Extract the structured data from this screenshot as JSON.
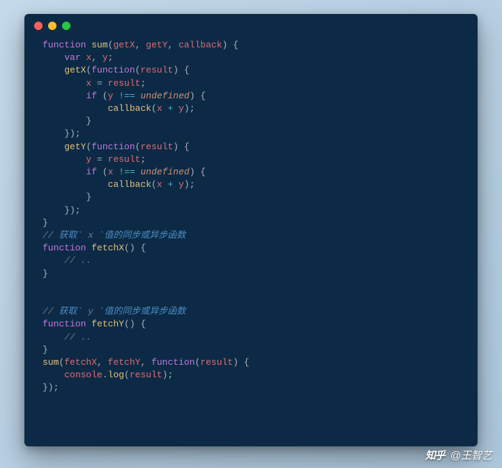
{
  "watermark": {
    "logo": "知乎",
    "attribution": "@王智艺"
  },
  "code_lines": [
    {
      "spans": [
        {
          "cls": "tok-kw",
          "t": "function"
        },
        {
          "cls": "tok-punc",
          "t": " "
        },
        {
          "cls": "tok-fn",
          "t": "sum"
        },
        {
          "cls": "tok-punc",
          "t": "("
        },
        {
          "cls": "tok-name",
          "t": "getX"
        },
        {
          "cls": "tok-punc",
          "t": ", "
        },
        {
          "cls": "tok-name",
          "t": "getY"
        },
        {
          "cls": "tok-punc",
          "t": ", "
        },
        {
          "cls": "tok-name",
          "t": "callback"
        },
        {
          "cls": "tok-punc",
          "t": ") {"
        }
      ]
    },
    {
      "spans": [
        {
          "cls": "tok-punc",
          "t": "    "
        },
        {
          "cls": "tok-kw",
          "t": "var"
        },
        {
          "cls": "tok-punc",
          "t": " "
        },
        {
          "cls": "tok-name",
          "t": "x"
        },
        {
          "cls": "tok-punc",
          "t": ", "
        },
        {
          "cls": "tok-name",
          "t": "y"
        },
        {
          "cls": "tok-punc",
          "t": ";"
        }
      ]
    },
    {
      "spans": [
        {
          "cls": "tok-punc",
          "t": "    "
        },
        {
          "cls": "tok-fn",
          "t": "getX"
        },
        {
          "cls": "tok-punc",
          "t": "("
        },
        {
          "cls": "tok-kw",
          "t": "function"
        },
        {
          "cls": "tok-punc",
          "t": "("
        },
        {
          "cls": "tok-name",
          "t": "result"
        },
        {
          "cls": "tok-punc",
          "t": ") {"
        }
      ]
    },
    {
      "spans": [
        {
          "cls": "tok-punc",
          "t": "        "
        },
        {
          "cls": "tok-name",
          "t": "x"
        },
        {
          "cls": "tok-punc",
          "t": " = "
        },
        {
          "cls": "tok-name",
          "t": "result"
        },
        {
          "cls": "tok-punc",
          "t": ";"
        }
      ]
    },
    {
      "spans": [
        {
          "cls": "tok-punc",
          "t": "        "
        },
        {
          "cls": "tok-kw",
          "t": "if"
        },
        {
          "cls": "tok-punc",
          "t": " ("
        },
        {
          "cls": "tok-name",
          "t": "y"
        },
        {
          "cls": "tok-punc",
          "t": " "
        },
        {
          "cls": "tok-op",
          "t": "!=="
        },
        {
          "cls": "tok-punc",
          "t": " "
        },
        {
          "cls": "tok-const",
          "t": "undefined"
        },
        {
          "cls": "tok-punc",
          "t": ") {"
        }
      ]
    },
    {
      "spans": [
        {
          "cls": "tok-punc",
          "t": "            "
        },
        {
          "cls": "tok-fn",
          "t": "callback"
        },
        {
          "cls": "tok-punc",
          "t": "("
        },
        {
          "cls": "tok-name",
          "t": "x"
        },
        {
          "cls": "tok-punc",
          "t": " "
        },
        {
          "cls": "tok-op",
          "t": "+"
        },
        {
          "cls": "tok-punc",
          "t": " "
        },
        {
          "cls": "tok-name",
          "t": "y"
        },
        {
          "cls": "tok-punc",
          "t": ");"
        }
      ]
    },
    {
      "spans": [
        {
          "cls": "tok-punc",
          "t": "        }"
        }
      ]
    },
    {
      "spans": [
        {
          "cls": "tok-punc",
          "t": "    });"
        }
      ]
    },
    {
      "spans": [
        {
          "cls": "tok-punc",
          "t": "    "
        },
        {
          "cls": "tok-fn",
          "t": "getY"
        },
        {
          "cls": "tok-punc",
          "t": "("
        },
        {
          "cls": "tok-kw",
          "t": "function"
        },
        {
          "cls": "tok-punc",
          "t": "("
        },
        {
          "cls": "tok-name",
          "t": "result"
        },
        {
          "cls": "tok-punc",
          "t": ") {"
        }
      ]
    },
    {
      "spans": [
        {
          "cls": "tok-punc",
          "t": "        "
        },
        {
          "cls": "tok-name",
          "t": "y"
        },
        {
          "cls": "tok-punc",
          "t": " = "
        },
        {
          "cls": "tok-name",
          "t": "result"
        },
        {
          "cls": "tok-punc",
          "t": ";"
        }
      ]
    },
    {
      "spans": [
        {
          "cls": "tok-punc",
          "t": "        "
        },
        {
          "cls": "tok-kw",
          "t": "if"
        },
        {
          "cls": "tok-punc",
          "t": " ("
        },
        {
          "cls": "tok-name",
          "t": "x"
        },
        {
          "cls": "tok-punc",
          "t": " "
        },
        {
          "cls": "tok-op",
          "t": "!=="
        },
        {
          "cls": "tok-punc",
          "t": " "
        },
        {
          "cls": "tok-const",
          "t": "undefined"
        },
        {
          "cls": "tok-punc",
          "t": ") {"
        }
      ]
    },
    {
      "spans": [
        {
          "cls": "tok-punc",
          "t": "            "
        },
        {
          "cls": "tok-fn",
          "t": "callback"
        },
        {
          "cls": "tok-punc",
          "t": "("
        },
        {
          "cls": "tok-name",
          "t": "x"
        },
        {
          "cls": "tok-punc",
          "t": " "
        },
        {
          "cls": "tok-op",
          "t": "+"
        },
        {
          "cls": "tok-punc",
          "t": " "
        },
        {
          "cls": "tok-name",
          "t": "y"
        },
        {
          "cls": "tok-punc",
          "t": ");"
        }
      ]
    },
    {
      "spans": [
        {
          "cls": "tok-punc",
          "t": "        }"
        }
      ]
    },
    {
      "spans": [
        {
          "cls": "tok-punc",
          "t": "    });"
        }
      ]
    },
    {
      "spans": [
        {
          "cls": "tok-punc",
          "t": "}"
        }
      ]
    },
    {
      "spans": [
        {
          "cls": "tok-cmt",
          "t": "// "
        },
        {
          "cls": "tok-cmt2",
          "t": "获取`"
        },
        {
          "cls": "tok-cmt",
          "t": " x "
        },
        {
          "cls": "tok-cmt2",
          "t": "`值的同步或异步函数"
        }
      ]
    },
    {
      "spans": [
        {
          "cls": "tok-kw",
          "t": "function"
        },
        {
          "cls": "tok-punc",
          "t": " "
        },
        {
          "cls": "tok-fn",
          "t": "fetchX"
        },
        {
          "cls": "tok-punc",
          "t": "() {"
        }
      ]
    },
    {
      "spans": [
        {
          "cls": "tok-punc",
          "t": "    "
        },
        {
          "cls": "tok-cmt",
          "t": "// .."
        }
      ]
    },
    {
      "spans": [
        {
          "cls": "tok-punc",
          "t": "}"
        }
      ]
    },
    {
      "spans": [
        {
          "cls": "tok-punc",
          "t": ""
        }
      ]
    },
    {
      "spans": [
        {
          "cls": "tok-punc",
          "t": ""
        }
      ]
    },
    {
      "spans": [
        {
          "cls": "tok-cmt",
          "t": "// "
        },
        {
          "cls": "tok-cmt2",
          "t": "获取`"
        },
        {
          "cls": "tok-cmt",
          "t": " y "
        },
        {
          "cls": "tok-cmt2",
          "t": "`值的同步或异步函数"
        }
      ]
    },
    {
      "spans": [
        {
          "cls": "tok-kw",
          "t": "function"
        },
        {
          "cls": "tok-punc",
          "t": " "
        },
        {
          "cls": "tok-fn",
          "t": "fetchY"
        },
        {
          "cls": "tok-punc",
          "t": "() {"
        }
      ]
    },
    {
      "spans": [
        {
          "cls": "tok-punc",
          "t": "    "
        },
        {
          "cls": "tok-cmt",
          "t": "// .."
        }
      ]
    },
    {
      "spans": [
        {
          "cls": "tok-punc",
          "t": "}"
        }
      ]
    },
    {
      "spans": [
        {
          "cls": "tok-fn",
          "t": "sum"
        },
        {
          "cls": "tok-punc",
          "t": "("
        },
        {
          "cls": "tok-name",
          "t": "fetchX"
        },
        {
          "cls": "tok-punc",
          "t": ", "
        },
        {
          "cls": "tok-name",
          "t": "fetchY"
        },
        {
          "cls": "tok-punc",
          "t": ", "
        },
        {
          "cls": "tok-kw",
          "t": "function"
        },
        {
          "cls": "tok-punc",
          "t": "("
        },
        {
          "cls": "tok-name",
          "t": "result"
        },
        {
          "cls": "tok-punc",
          "t": ") {"
        }
      ]
    },
    {
      "spans": [
        {
          "cls": "tok-punc",
          "t": "    "
        },
        {
          "cls": "tok-name",
          "t": "console"
        },
        {
          "cls": "tok-punc",
          "t": "."
        },
        {
          "cls": "tok-fn",
          "t": "log"
        },
        {
          "cls": "tok-punc",
          "t": "("
        },
        {
          "cls": "tok-name",
          "t": "result"
        },
        {
          "cls": "tok-punc",
          "t": ");"
        }
      ]
    },
    {
      "spans": [
        {
          "cls": "tok-punc",
          "t": "});"
        }
      ]
    }
  ]
}
